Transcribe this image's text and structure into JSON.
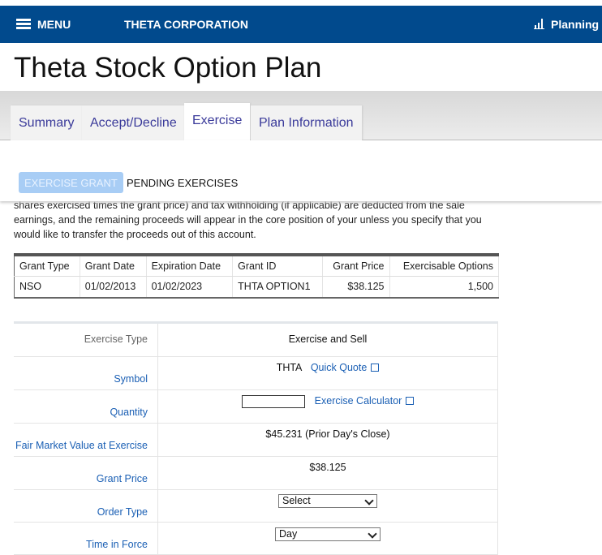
{
  "header": {
    "menu": "MENU",
    "company": "THETA CORPORATION",
    "planning": "Planning"
  },
  "title": "Theta Stock Option Plan",
  "tabs": [
    "Summary",
    "Accept/Decline",
    "Exercise",
    "Plan Information"
  ],
  "active_tab": "Exercise",
  "subnav": {
    "exercise_grant": "EXERCISE GRANT",
    "pending": "PENDING EXERCISES"
  },
  "intro": "shares exercised times the grant price) and tax withholding (if applicable) are deducted from the sale earnings, and the remaining proceeds will appear in the core position of your unless you specify that you would like to transfer the proceeds out of this account.",
  "grants": {
    "headers": [
      "Grant Type",
      "Grant Date",
      "Expiration Date",
      "Grant ID",
      "Grant Price",
      "Exercisable Options"
    ],
    "rows": [
      [
        "NSO",
        "01/02/2013",
        "01/02/2023",
        "THTA OPTION1",
        "$38.125",
        "1,500"
      ]
    ]
  },
  "form": {
    "exercise_type_label": "Exercise Type",
    "exercise_type": "Exercise and Sell",
    "symbol_label": "Symbol",
    "symbol": "THTA",
    "quick_quote": "Quick Quote",
    "quantity_label": "Quantity",
    "quantity_value": "",
    "exercise_calculator": "Exercise Calculator",
    "fmv_label": "Fair Market Value at Exercise",
    "fmv": "$45.231 (Prior Day's Close)",
    "grant_price_label": "Grant Price",
    "grant_price": "$38.125",
    "order_type_label": "Order Type",
    "order_type": "Select",
    "tif_label": "Time in Force",
    "tif": "Day"
  },
  "colors": {
    "header": "#014a8d",
    "link": "#1a5fb4",
    "pill": "#a8cdf5"
  }
}
